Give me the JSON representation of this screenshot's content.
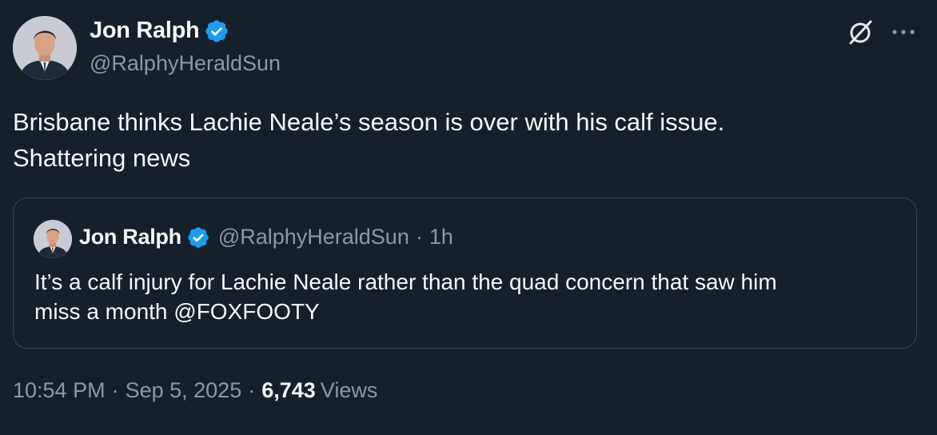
{
  "author": {
    "name": "Jon Ralph",
    "handle": "@RalphyHeraldSun",
    "verified": true
  },
  "icons": {
    "verified": "verified-badge-icon",
    "grok": "grok-icon",
    "more": "more-options-icon"
  },
  "tweet": {
    "text_lines": [
      "Brisbane thinks Lachie Neale’s season is over with his calf issue.",
      "Shattering news"
    ]
  },
  "quote": {
    "name": "Jon Ralph",
    "handle": "@RalphyHeraldSun",
    "dot": "·",
    "time": "1h",
    "text_lines": [
      "It’s a calf injury for Lachie Neale rather than the quad concern that saw him",
      "miss a month @FOXFOOTY"
    ]
  },
  "meta": {
    "time": "10:54 PM",
    "date": "Sep 5, 2025",
    "separator": "·",
    "views_count": "6,743",
    "views_label": "Views"
  },
  "colors": {
    "background": "#15202b",
    "primary_text": "#f7f9f9",
    "secondary_text": "#8b98a5",
    "verified_blue": "#1d9bf0",
    "border": "#38444d"
  }
}
